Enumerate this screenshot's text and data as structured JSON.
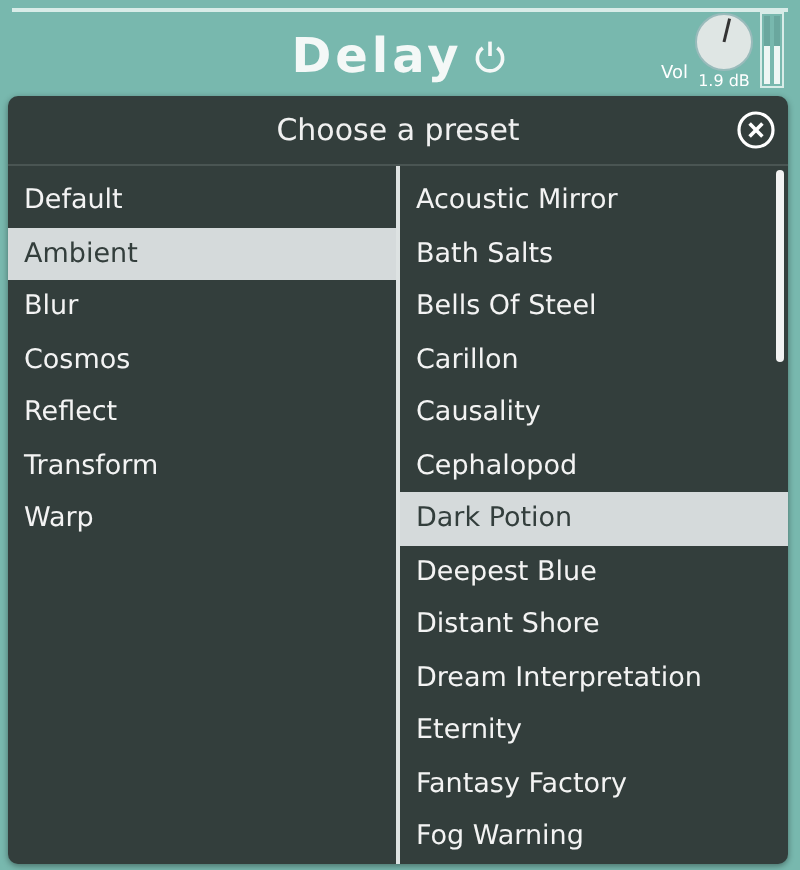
{
  "plugin": {
    "title": "Delay",
    "power_on": true,
    "volume": {
      "label": "Vol",
      "reading": "1.9 dB",
      "level": 0.55
    }
  },
  "dialog": {
    "title": "Choose a preset",
    "categories": [
      {
        "label": "Default",
        "selected": false
      },
      {
        "label": "Ambient",
        "selected": true
      },
      {
        "label": "Blur",
        "selected": false
      },
      {
        "label": "Cosmos",
        "selected": false
      },
      {
        "label": "Reflect",
        "selected": false
      },
      {
        "label": "Transform",
        "selected": false
      },
      {
        "label": "Warp",
        "selected": false
      }
    ],
    "presets": [
      {
        "label": "Acoustic Mirror",
        "selected": false
      },
      {
        "label": "Bath Salts",
        "selected": false
      },
      {
        "label": "Bells Of Steel",
        "selected": false
      },
      {
        "label": "Carillon",
        "selected": false
      },
      {
        "label": "Causality",
        "selected": false
      },
      {
        "label": "Cephalopod",
        "selected": false
      },
      {
        "label": "Dark Potion",
        "selected": true
      },
      {
        "label": "Deepest Blue",
        "selected": false
      },
      {
        "label": "Distant Shore",
        "selected": false
      },
      {
        "label": "Dream Interpretation",
        "selected": false
      },
      {
        "label": "Eternity",
        "selected": false
      },
      {
        "label": "Fantasy Factory",
        "selected": false
      },
      {
        "label": "Fog Warning",
        "selected": false
      }
    ]
  }
}
